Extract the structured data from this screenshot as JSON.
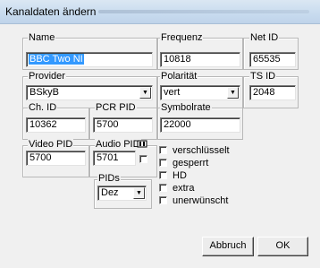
{
  "window": {
    "title": "Kanaldaten ändern"
  },
  "fields": {
    "name": {
      "label": "Name",
      "value": "BBC Two NI"
    },
    "frequenz": {
      "label": "Frequenz",
      "value": "10818"
    },
    "net_id": {
      "label": "Net ID",
      "value": "65535"
    },
    "provider": {
      "label": "Provider",
      "value": "BSkyB"
    },
    "polaritaet": {
      "label": "Polarität",
      "value": "vert"
    },
    "ts_id": {
      "label": "TS ID",
      "value": "2048"
    },
    "ch_id": {
      "label": "Ch. ID",
      "value": "10362"
    },
    "pcr_pid": {
      "label": "PCR PID",
      "value": "5700"
    },
    "symbolrate": {
      "label": "Symbolrate",
      "value": "22000"
    },
    "video_pid": {
      "label": "Video PID",
      "value": "5700"
    },
    "audio_pid": {
      "label": "Audio PID",
      "value": "5701"
    },
    "pids": {
      "label": "PIDs",
      "value": "Dez"
    }
  },
  "checkboxes": [
    {
      "label": "verschlüsselt",
      "checked": false
    },
    {
      "label": "gesperrt",
      "checked": false
    },
    {
      "label": "HD",
      "checked": false
    },
    {
      "label": "extra",
      "checked": false
    },
    {
      "label": "unerwünscht",
      "checked": false
    }
  ],
  "buttons": {
    "cancel": "Abbruch",
    "ok": "OK"
  },
  "icons": {
    "dropdown": "chevron-down-icon",
    "audio_toggle": "audio-pid-icon"
  }
}
